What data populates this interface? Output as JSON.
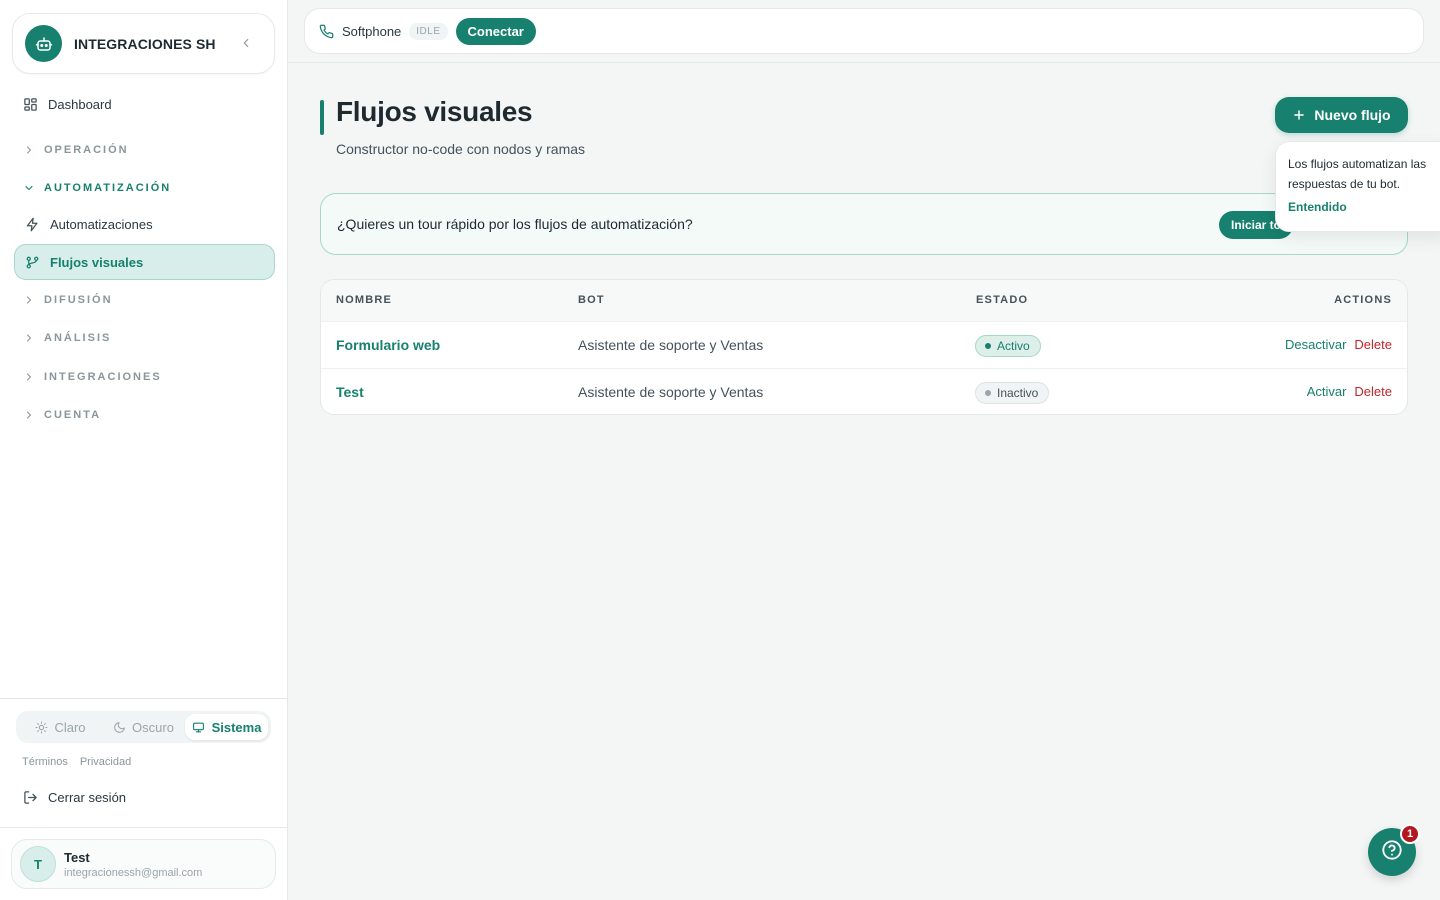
{
  "sidebar": {
    "brand_name": "INTEGRACIONES SH",
    "dashboard_label": "Dashboard",
    "sections": {
      "operacion": "OPERACIÓN",
      "automatizacion": "AUTOMATIZACIÓN",
      "difusion": "DIFUSIÓN",
      "analisis": "ANÁLISIS",
      "integraciones": "INTEGRACIONES",
      "cuenta": "CUENTA"
    },
    "items": {
      "automatizaciones": "Automatizaciones",
      "flujos_visuales": "Flujos visuales"
    },
    "theme": {
      "claro": "Claro",
      "oscuro": "Oscuro",
      "sistema": "Sistema",
      "selected": "Sistema"
    },
    "legal": {
      "terminos": "Términos",
      "privacidad": "Privacidad"
    },
    "logout_label": "Cerrar sesión",
    "user": {
      "initial": "T",
      "name": "Test",
      "email": "integracionessh@gmail.com"
    }
  },
  "topbar": {
    "softphone_label": "Softphone",
    "status": "IDLE",
    "connect_label": "Conectar"
  },
  "main": {
    "title": "Flujos visuales",
    "subtitle": "Constructor no-code con nodos y ramas",
    "new_button_label": "Nuevo flujo",
    "tour": {
      "text": "¿Quieres un tour rápido por los flujos de automatización?",
      "button_label": "Iniciar to"
    },
    "popover": {
      "text": "Los flujos automatizan las respuestas de tu bot.",
      "link": "Entendido"
    },
    "table": {
      "headers": {
        "nombre": "NOMBRE",
        "bot": "BOT",
        "estado": "ESTADO",
        "actions": "ACTIONS"
      },
      "rows": [
        {
          "nombre": "Formulario web",
          "bot": "Asistente de soporte y Ventas",
          "estado": "Activo",
          "toggle": "Desactivar",
          "delete": "Delete"
        },
        {
          "nombre": "Test",
          "bot": "Asistente de soporte y Ventas",
          "estado": "Inactivo",
          "toggle": "Activar",
          "delete": "Delete"
        }
      ]
    }
  },
  "help": {
    "badge_count": "1"
  },
  "colors": {
    "accent": "#17806e",
    "danger": "#c0262d",
    "background": "#f3f6f5"
  },
  "icons": [
    "bot-icon",
    "chevron-left-icon",
    "dashboard-grid-icon",
    "chevron-right-icon",
    "chevron-down-icon",
    "zap-icon",
    "git-branch-icon",
    "sun-icon",
    "moon-icon",
    "monitor-icon",
    "logout-icon",
    "phone-icon",
    "plus-icon",
    "help-circle-icon"
  ]
}
